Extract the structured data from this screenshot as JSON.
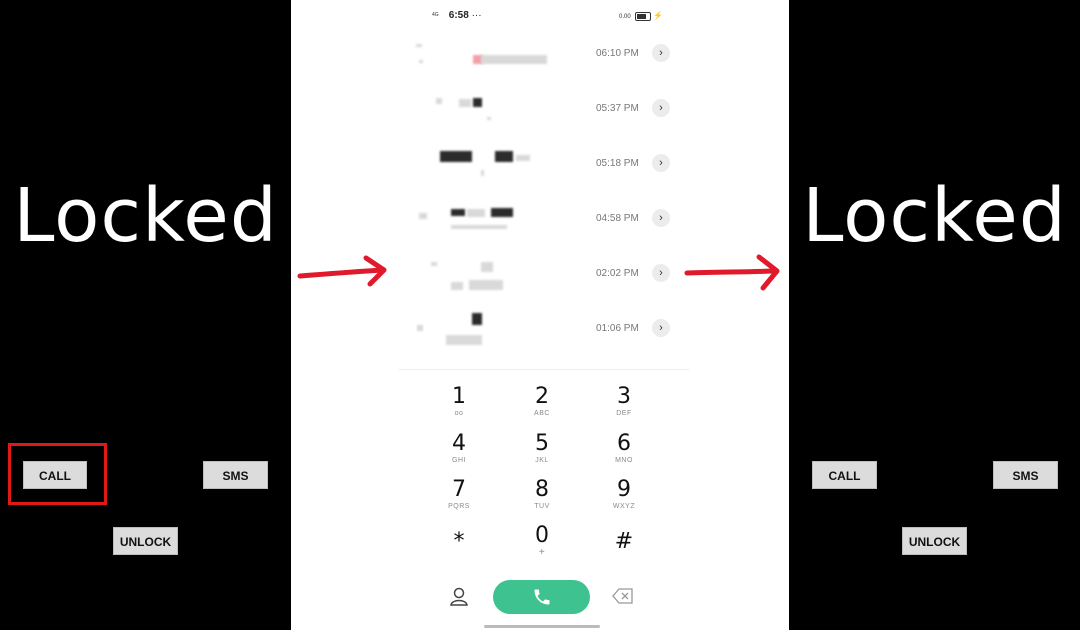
{
  "left_screen": {
    "title": "Locked",
    "buttons": {
      "call": "CALL",
      "sms": "SMS",
      "unlock": "UNLOCK"
    }
  },
  "right_screen": {
    "title": "Locked",
    "buttons": {
      "call": "CALL",
      "sms": "SMS",
      "unlock": "UNLOCK"
    }
  },
  "phone": {
    "status": {
      "network": "4G",
      "time": "6:58",
      "dots": "···",
      "speed": "0.00",
      "bolt": "⚡"
    },
    "recent_calls": [
      {
        "time": "06:10 PM"
      },
      {
        "time": "05:37 PM"
      },
      {
        "time": "05:18 PM"
      },
      {
        "time": "04:58 PM"
      },
      {
        "time": "02:02 PM"
      },
      {
        "time": "01:06 PM"
      }
    ],
    "keypad": [
      {
        "digit": "1",
        "letters": "ᴏᴏ"
      },
      {
        "digit": "2",
        "letters": "ABC"
      },
      {
        "digit": "3",
        "letters": "DEF"
      },
      {
        "digit": "4",
        "letters": "GHI"
      },
      {
        "digit": "5",
        "letters": "JKL"
      },
      {
        "digit": "6",
        "letters": "MNO"
      },
      {
        "digit": "7",
        "letters": "PQRS"
      },
      {
        "digit": "8",
        "letters": "TUV"
      },
      {
        "digit": "9",
        "letters": "WXYZ"
      },
      {
        "digit": "*",
        "letters": ""
      },
      {
        "digit": "0",
        "letters": "+"
      },
      {
        "digit": "#",
        "letters": ""
      }
    ]
  },
  "colors": {
    "highlight": "#e01818",
    "arrow": "#e0192b",
    "call_button": "#3dc290"
  }
}
